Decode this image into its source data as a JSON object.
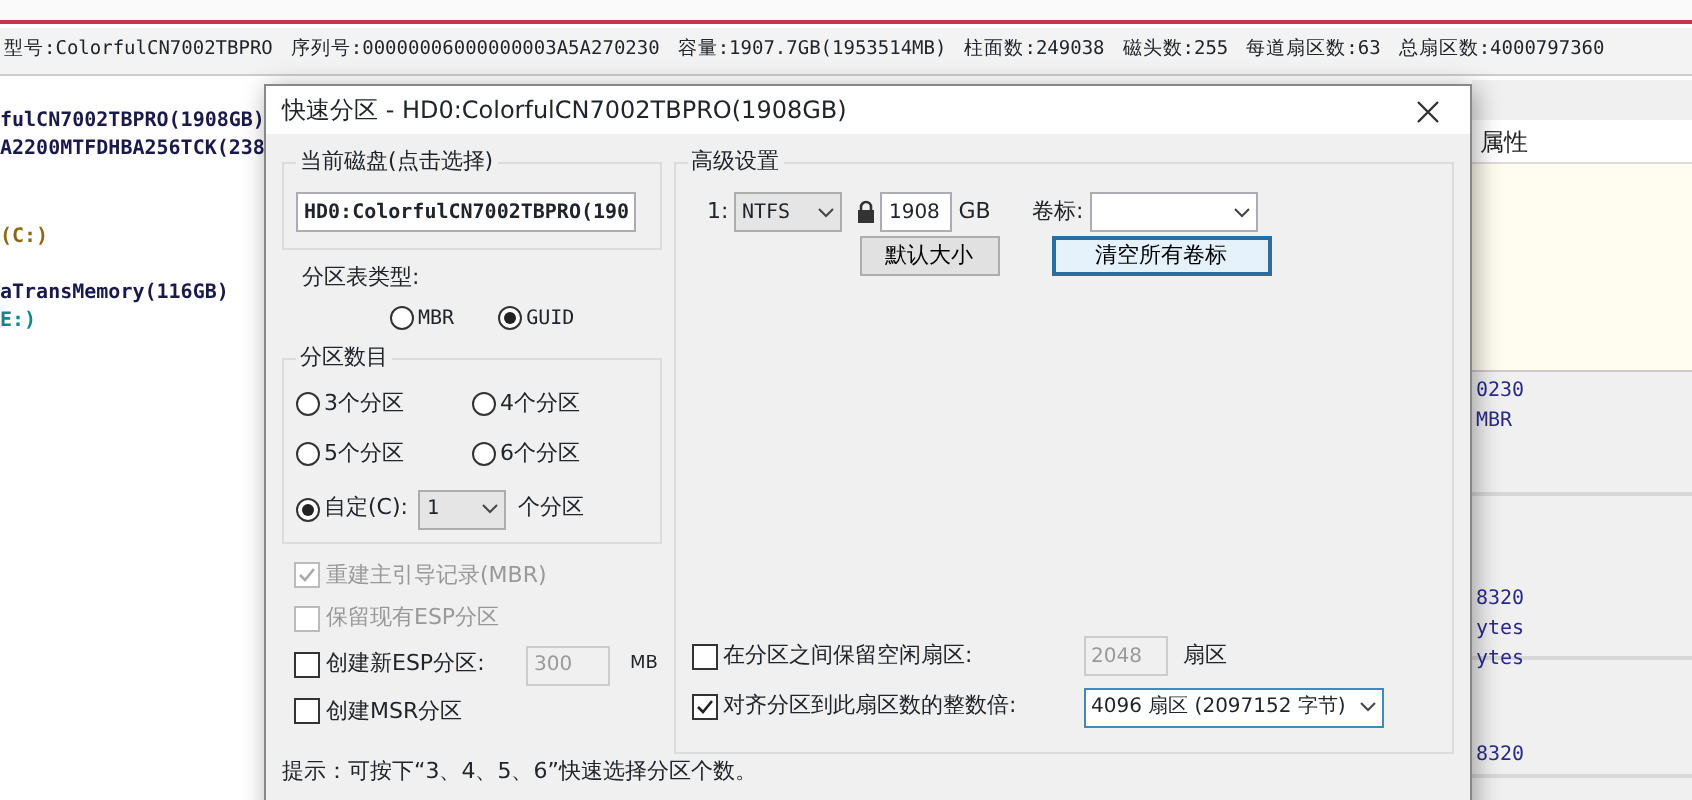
{
  "info_bar": [
    "型号:ColorfulCN7002TBPRO",
    "序列号:00000006000000003A5A270230",
    "容量:1907.7GB(1953514MB)",
    "柱面数:249038",
    "磁头数:255",
    "每道扇区数:63",
    "总扇区数:4000797360"
  ],
  "disk_tree": [
    {
      "label": "fulCN7002TBPRO(1908GB)",
      "color": "#1a1a4a"
    },
    {
      "label": "A2200MTFDHBA256TCK(238",
      "color": "#1a1a4a"
    },
    {
      "label": "(C:)",
      "color": "#8a6a10"
    },
    {
      "label": "aTransMemory(116GB)",
      "color": "#1a1a4a"
    },
    {
      "label": "E:)",
      "color": "#0a8a8a"
    }
  ],
  "properties_header": "属性",
  "detail_sections": [
    [
      "0230",
      "MBR"
    ],
    [
      "8320",
      "ytes",
      "ytes"
    ],
    [
      "8320"
    ]
  ],
  "dialog": {
    "title": "快速分区 - HD0:ColorfulCN7002TBPRO(1908GB)",
    "current_disk": {
      "label": "当前磁盘(点击选择)",
      "value": "HD0:ColorfulCN7002TBPRO(190"
    },
    "partition_table": {
      "label": "分区表类型:",
      "options": [
        {
          "label": "MBR",
          "selected": false
        },
        {
          "label": "GUID",
          "selected": true
        }
      ]
    },
    "partition_count": {
      "label": "分区数目",
      "options": [
        {
          "label": "3个分区",
          "selected": false
        },
        {
          "label": "4个分区",
          "selected": false
        },
        {
          "label": "5个分区",
          "selected": false
        },
        {
          "label": "6个分区",
          "selected": false
        }
      ],
      "custom": {
        "label": "自定(C):",
        "selected": true,
        "value": "1",
        "unit": "个分区"
      }
    },
    "options": [
      {
        "kind": "checkbox",
        "label": "重建主引导记录(MBR)",
        "checked": true,
        "disabled": true
      },
      {
        "kind": "checkbox",
        "label": "保留现有ESP分区",
        "checked": false,
        "disabled": true
      },
      {
        "kind": "size",
        "label": "创建新ESP分区:",
        "checked": false,
        "disabled": false,
        "value": "300",
        "unit": "MB"
      },
      {
        "kind": "checkbox",
        "label": "创建MSR分区",
        "checked": false,
        "disabled": false
      }
    ],
    "advanced": {
      "label": "高级设置",
      "index": "1:",
      "filesystem": "NTFS",
      "size": "1908",
      "size_unit": "GB",
      "volume_label": "卷标:",
      "buttons": [
        {
          "label": "默认大小",
          "focused": false
        },
        {
          "label": "清空所有卷标",
          "focused": true
        }
      ],
      "options": [
        {
          "kind": "field",
          "label": "在分区之间保留空闲扇区:",
          "checked": false,
          "value": "2048",
          "unit": "扇区"
        },
        {
          "kind": "dropdown",
          "label": "对齐分区到此扇区数的整数倍:",
          "checked": true,
          "value": "4096 扇区 (2097152 字节)"
        }
      ]
    },
    "hint": "提示：可按下“3、4、5、6”快速选择分区个数。"
  }
}
